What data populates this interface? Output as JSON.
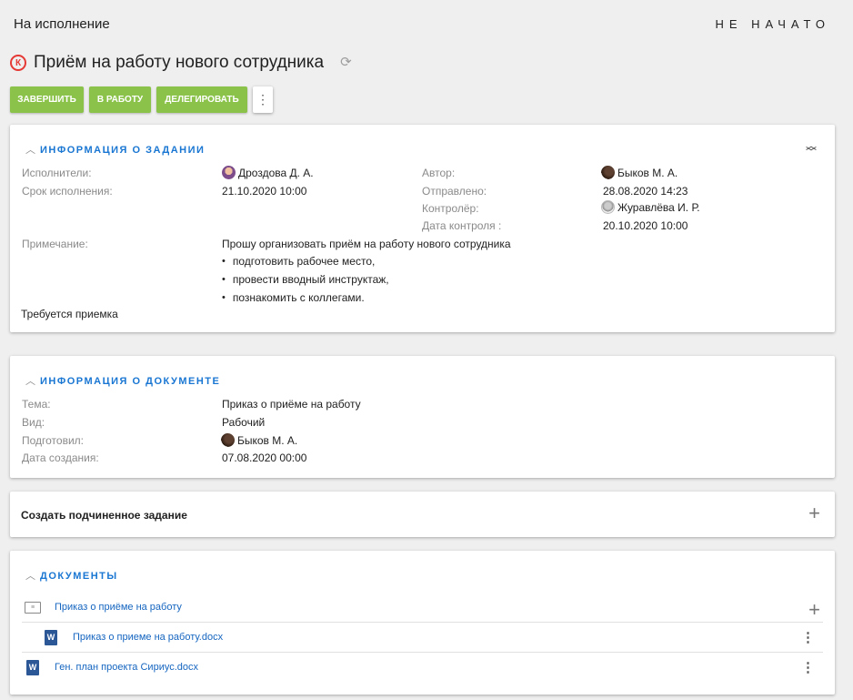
{
  "header": {
    "section": "На исполнение",
    "status": "НЕ НАЧАТО"
  },
  "task": {
    "marker": "К",
    "title": "Приём на работу нового сотрудника"
  },
  "toolbar": {
    "complete_label": "ЗАВЕРШИТЬ",
    "start_label": "В РАБОТУ",
    "delegate_label": "ДЕЛЕГИРОВАТЬ",
    "more_label": "⋮"
  },
  "task_info": {
    "title": "ИНФОРМАЦИЯ О ЗАДАНИИ",
    "executors_label": "Исполнители:",
    "executors_value": "Дроздова Д. А.",
    "deadline_label": "Срок исполнения:",
    "deadline_value": "21.10.2020 10:00",
    "author_label": "Автор:",
    "author_value": "Быков М. А.",
    "sent_label": "Отправлено:",
    "sent_value": "28.08.2020 14:23",
    "controller_label": "Контролёр:",
    "controller_value": "Журавлёва И. Р.",
    "control_date_label": "Дата контроля :",
    "control_date_value": "20.10.2020 10:00",
    "note_label": "Примечание:",
    "note_text": "Прошу организовать приём на работу нового сотрудника",
    "note_items": [
      "подготовить рабочее место,",
      "провести вводный инструктаж,",
      "познакомить с коллегами."
    ],
    "requires_acceptance": "Требуется приемка"
  },
  "doc_info": {
    "title": "ИНФОРМАЦИЯ О ДОКУМЕНТЕ",
    "subject_label": "Тема:",
    "subject_value": "Приказ о приёме на работу",
    "kind_label": "Вид:",
    "kind_value": "Рабочий",
    "prepared_label": "Подготовил:",
    "prepared_value": "Быков М. А.",
    "created_label": "Дата создания:",
    "created_value": "07.08.2020 00:00"
  },
  "subtask": {
    "label": "Создать подчиненное задание"
  },
  "documents": {
    "title": "ДОКУМЕНТЫ",
    "items": [
      {
        "name": "Приказ о приёме на работу",
        "icon": "order-document-icon"
      },
      {
        "name": "Приказ о приеме на работу.docx",
        "icon": "word-file-icon"
      },
      {
        "name": "Ген. план проекта Сириус.docx",
        "icon": "word-file-icon"
      }
    ]
  },
  "icons": {
    "word_letter": "W",
    "order_glyph": "≡"
  },
  "colors": {
    "accent": "#1976d2",
    "button_green": "#8bc34a",
    "marker_red": "#e53935",
    "word_blue": "#2b5797"
  }
}
